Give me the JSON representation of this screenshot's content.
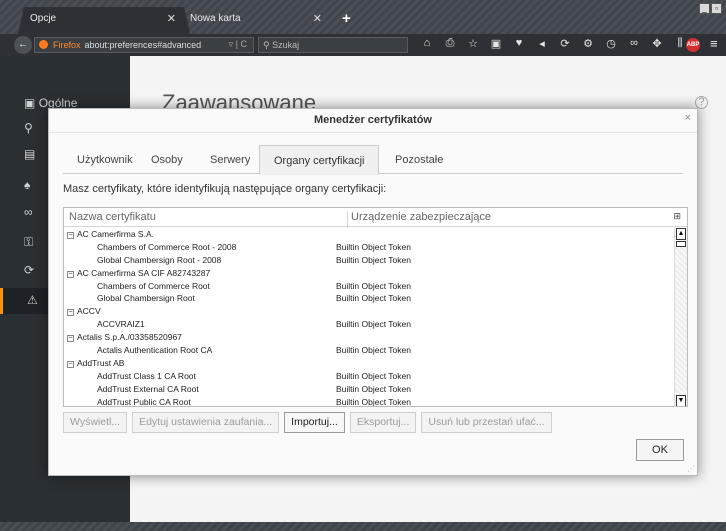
{
  "browser": {
    "tabs": [
      {
        "label": "Opcje",
        "active": true
      },
      {
        "label": "Nowa karta",
        "active": false
      }
    ],
    "new_tab": "+",
    "window_buttons": [
      "_",
      "▫"
    ],
    "back": "←",
    "url_brand": "Firefox",
    "url": "about:preferences#advanced",
    "url_controls": "▿ | C",
    "search_placeholder": "Szukaj",
    "toolbar_icons": [
      "home-icon",
      "print-icon",
      "bookmark-icon",
      "library-icon",
      "pocket-icon",
      "send-icon",
      "sync-icon",
      "gear-icon",
      "history-icon",
      "mask-icon",
      "puzzle-icon",
      "bars-icon"
    ],
    "abp": "ABP",
    "menu": "≡"
  },
  "prefs": {
    "sidebar": [
      {
        "label": "Ogólne",
        "icon": "general-icon"
      },
      {
        "label": "",
        "icon": "search-icon"
      },
      {
        "label": "",
        "icon": "content-icon"
      },
      {
        "label": "",
        "icon": "applications-icon"
      },
      {
        "label": "",
        "icon": "privacy-icon"
      },
      {
        "label": "",
        "icon": "security-icon"
      },
      {
        "label": "",
        "icon": "sync-icon"
      },
      {
        "label": "",
        "icon": "advanced-icon",
        "selected": true
      }
    ],
    "heading": "Zaawansowane",
    "help": "?"
  },
  "dialog": {
    "title": "Menedżer certyfikatów",
    "close": "×",
    "tabs": [
      {
        "label": "Użytkownik",
        "active": false
      },
      {
        "label": "Osoby",
        "active": false
      },
      {
        "label": "Serwery",
        "active": false
      },
      {
        "label": "Organy certyfikacji",
        "active": true
      },
      {
        "label": "Pozostałe",
        "active": false
      }
    ],
    "intro": "Masz certyfikaty, które identyfikują następujące organy certyfikacji:",
    "columns": {
      "name": "Nazwa certyfikatu",
      "device": "Urządzenie zabezpieczające"
    },
    "rows": [
      {
        "level": 0,
        "toggle": "−",
        "name": "AC Camerfirma S.A.",
        "device": ""
      },
      {
        "level": 1,
        "name": "Chambers of Commerce Root - 2008",
        "device": "Builtin Object Token"
      },
      {
        "level": 1,
        "name": "Global Chambersign Root - 2008",
        "device": "Builtin Object Token"
      },
      {
        "level": 0,
        "toggle": "−",
        "name": "AC Camerfirma SA CIF A82743287",
        "device": ""
      },
      {
        "level": 1,
        "name": "Chambers of Commerce Root",
        "device": "Builtin Object Token"
      },
      {
        "level": 1,
        "name": "Global Chambersign Root",
        "device": "Builtin Object Token"
      },
      {
        "level": 0,
        "toggle": "−",
        "name": "ACCV",
        "device": ""
      },
      {
        "level": 1,
        "name": "ACCVRAIZ1",
        "device": "Builtin Object Token"
      },
      {
        "level": 0,
        "toggle": "−",
        "name": "Actalis S.p.A./03358520967",
        "device": ""
      },
      {
        "level": 1,
        "name": "Actalis Authentication Root CA",
        "device": "Builtin Object Token"
      },
      {
        "level": 0,
        "toggle": "−",
        "name": "AddTrust AB",
        "device": ""
      },
      {
        "level": 1,
        "name": "AddTrust Class 1 CA Root",
        "device": "Builtin Object Token"
      },
      {
        "level": 1,
        "name": "AddTrust External CA Root",
        "device": "Builtin Object Token"
      },
      {
        "level": 1,
        "name": "AddTrust Public CA Root",
        "device": "Builtin Object Token"
      }
    ],
    "buttons": [
      {
        "label": "Wyświetl...",
        "enabled": false,
        "name": "view-button"
      },
      {
        "label": "Edytuj ustawienia zaufania...",
        "enabled": false,
        "name": "edit-trust-button"
      },
      {
        "label": "Importuj...",
        "enabled": true,
        "name": "import-button"
      },
      {
        "label": "Eksportuj...",
        "enabled": false,
        "name": "export-button"
      },
      {
        "label": "Usuń lub przestań ufać...",
        "enabled": false,
        "name": "delete-button"
      }
    ],
    "ok": "OK"
  }
}
